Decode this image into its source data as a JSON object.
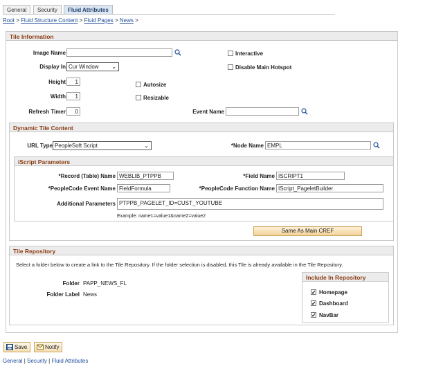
{
  "tabs": [
    {
      "label": "General"
    },
    {
      "label": "Security"
    },
    {
      "label": "Fluid Attributes"
    }
  ],
  "breadcrumb": {
    "items": [
      "Root",
      "Fluid Structure Content",
      "Fluid Pages",
      "News"
    ],
    "separator": ">"
  },
  "tile_info": {
    "title": "Tile Information",
    "image_name_label": "Image Name",
    "image_name_value": "",
    "display_in_label": "Display In",
    "display_in_value": "Cur Window",
    "height_label": "Height",
    "height_value": "1",
    "width_label": "Width",
    "width_value": "1",
    "refresh_label": "Refresh Timer",
    "refresh_value": "0",
    "autosize_label": "Autosize",
    "resizable_label": "Resizable",
    "interactive_label": "Interactive",
    "disable_hotspot_label": "Disable Main Hotspot",
    "event_name_label": "Event Name",
    "event_name_value": ""
  },
  "dynamic": {
    "title": "Dynamic Tile Content",
    "url_type_label": "URL Type",
    "url_type_value": "PeopleSoft Script",
    "node_name_label": "*Node Name",
    "node_name_value": "EMPL"
  },
  "iscript": {
    "title": "iScript Parameters",
    "record_label": "*Record (Table) Name",
    "record_value": "WEBLIB_PTPPB",
    "field_label": "*Field Name",
    "field_value": "ISCRIPT1",
    "event_label": "*PeopleCode Event Name",
    "event_value": "FieldFormula",
    "function_label": "*PeopleCode Function Name",
    "function_value": "IScript_PageletBuilder",
    "additional_label": "Additional Parameters",
    "additional_value": "PTPPB_PAGELET_ID=CUST_YOUTUBE",
    "example_text": "Example: name1=value1&name2=value2",
    "same_as_button": "Same As Main CREF"
  },
  "repository": {
    "title": "Tile Repository",
    "instruction": "Select a folder below to create a link to the Tile Repository. If the folder selection is disabled, this Tile is already available in the Tile Repository.",
    "folder_label": "Folder",
    "folder_value": "PAPP_NEWS_FL",
    "folder_label_label": "Folder Label",
    "folder_label_value": "News",
    "include_title": "Include In Repository",
    "homepage_label": "Homepage",
    "dashboard_label": "Dashboard",
    "navbar_label": "NavBar",
    "homepage_checked": true,
    "dashboard_checked": true,
    "navbar_checked": true
  },
  "toolbar": {
    "save_label": "Save",
    "notify_label": "Notify"
  },
  "footer_links": {
    "general": "General",
    "security": "Security",
    "fluid": "Fluid Attributes",
    "separator": "|"
  },
  "colors": {
    "section_title": "#8a3b12",
    "link": "#1f4e9c",
    "button_fill": "#f3d29a"
  }
}
